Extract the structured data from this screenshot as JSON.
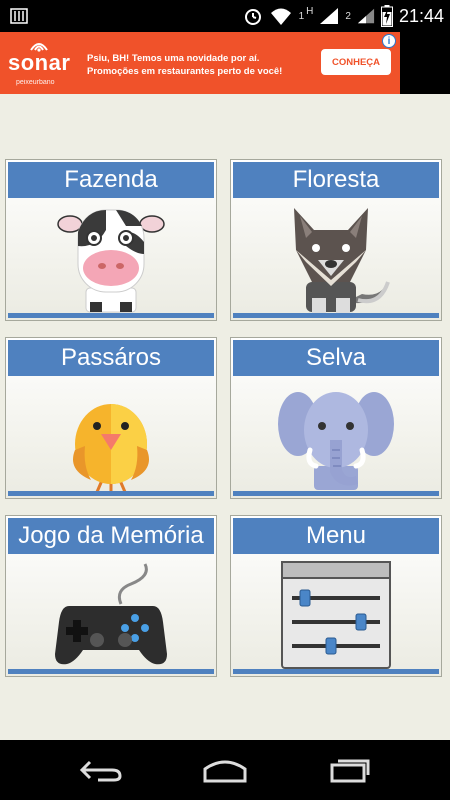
{
  "status_bar": {
    "time": "21:44",
    "sim1": "1",
    "sim2": "2",
    "network": "H"
  },
  "ad": {
    "brand": "sonar",
    "brand_sub": "peixeurbano",
    "line1": "Psiu, BH! Temos uma novidade por aí.",
    "line2": "Promoções em restaurantes perto de você!",
    "cta": "CONHEÇA",
    "info": "i"
  },
  "tiles": [
    {
      "label": "Fazenda",
      "icon": "cow-icon"
    },
    {
      "label": "Floresta",
      "icon": "wolf-icon"
    },
    {
      "label": "Passáros",
      "icon": "bird-icon"
    },
    {
      "label": "Selva",
      "icon": "elephant-icon"
    },
    {
      "label": "Jogo da Memória",
      "icon": "gamepad-icon"
    },
    {
      "label": "Menu",
      "icon": "settings-sliders-icon"
    }
  ],
  "colors": {
    "tile_header": "#4f81bf",
    "ad_background": "#f0522a",
    "page_background": "#eeeee4"
  }
}
